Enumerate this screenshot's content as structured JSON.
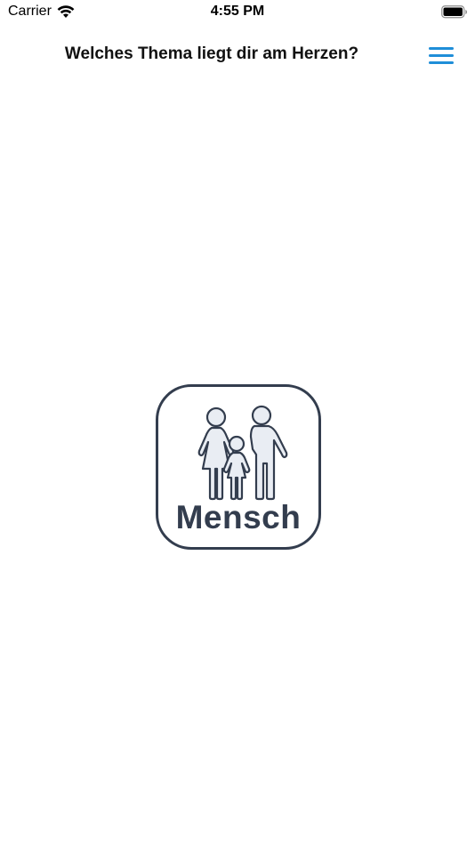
{
  "status_bar": {
    "carrier": "Carrier",
    "time": "4:55 PM",
    "icons": [
      "wifi-icon",
      "battery-icon"
    ]
  },
  "nav": {
    "title": "Welches Thema liegt dir am Herzen?",
    "menu_icon": "hamburger-menu-icon",
    "accent_color": "#1f8ed8"
  },
  "topic": {
    "label": "Mensch",
    "icon": "family-icon",
    "color": "#333d4e"
  }
}
